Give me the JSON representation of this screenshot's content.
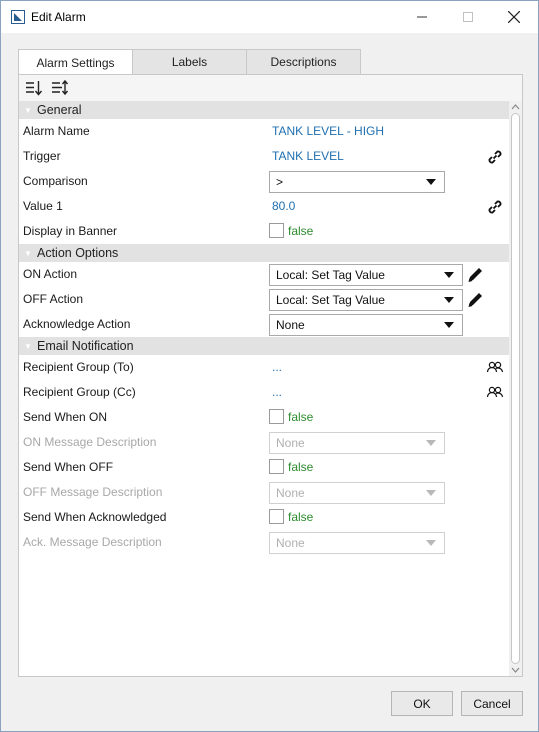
{
  "window": {
    "title": "Edit Alarm",
    "minimize_glyph": "–",
    "maximize_glyph": "☐",
    "close_glyph": "✕"
  },
  "tabs": [
    "Alarm Settings",
    "Labels",
    "Descriptions"
  ],
  "toolbar": {
    "icons": [
      "sort-descending-icon",
      "sort-custom-icon"
    ]
  },
  "sections": {
    "general": "General",
    "action_options": "Action Options",
    "email_notification": "Email Notification"
  },
  "general": {
    "alarm_name_label": "Alarm Name",
    "alarm_name_value": "TANK LEVEL - HIGH",
    "trigger_label": "Trigger",
    "trigger_value": "TANK LEVEL",
    "comparison_label": "Comparison",
    "comparison_value": ">",
    "value1_label": "Value 1",
    "value1_value": "80.0",
    "display_in_banner_label": "Display in Banner",
    "display_in_banner_value": "false"
  },
  "actions": {
    "on_action_label": "ON Action",
    "on_action_value": "Local: Set Tag Value",
    "off_action_label": "OFF Action",
    "off_action_value": "Local: Set Tag Value",
    "ack_action_label": "Acknowledge Action",
    "ack_action_value": "None"
  },
  "email": {
    "recipient_to_label": "Recipient Group (To)",
    "recipient_to_value": "...",
    "recipient_cc_label": "Recipient Group (Cc)",
    "recipient_cc_value": "...",
    "send_on_label": "Send When ON",
    "send_on_value": "false",
    "on_msg_label": "ON Message Description",
    "on_msg_value": "None",
    "send_off_label": "Send When OFF",
    "send_off_value": "false",
    "off_msg_label": "OFF Message Description",
    "off_msg_value": "None",
    "send_ack_label": "Send When Acknowledged",
    "send_ack_value": "false",
    "ack_msg_label": "Ack. Message Description",
    "ack_msg_value": "None"
  },
  "buttons": {
    "ok": "OK",
    "cancel": "Cancel"
  },
  "colors": {
    "link_blue": "#1f6fb0",
    "false_green": "#2e8b2e",
    "disabled_gray": "#a8a8a8",
    "section_gray": "#e2e2e2"
  }
}
